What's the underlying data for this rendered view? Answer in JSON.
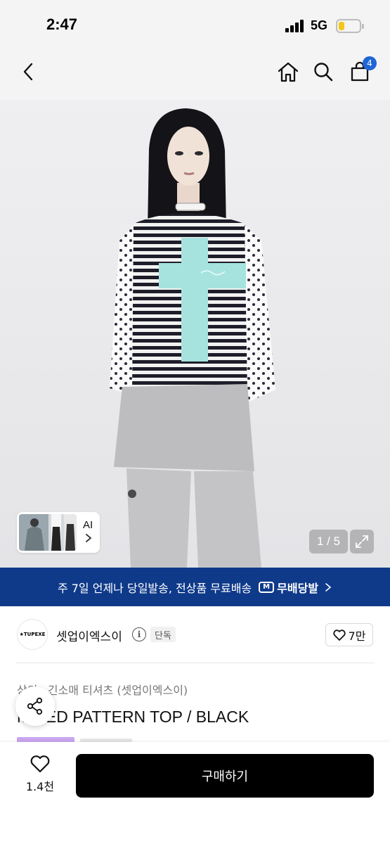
{
  "status_bar": {
    "time": "2:47",
    "network": "5G",
    "battery_level": 0.3
  },
  "nav": {
    "cart_count": "4",
    "icons": [
      "back-chevron-icon",
      "home-icon",
      "search-icon",
      "cart-icon"
    ]
  },
  "gallery": {
    "counter": "1 / 5",
    "ai_label": "AI"
  },
  "delivery_banner": {
    "text": "주 7일 언제나 당일발송, 전상품 무료배송",
    "brand": "무배당발"
  },
  "brand": {
    "logo_text": "★TUPEXE",
    "name": "셋업이엑스이",
    "badge": "단독",
    "likes": "7만"
  },
  "breadcrumb": [
    "상의",
    "긴소매 티셔츠 (셋업이엑스이)"
  ],
  "product": {
    "title": "MIXED PATTERN TOP / BLACK"
  },
  "bottom_bar": {
    "wish_count": "1.4천",
    "buy_label": "구매하기"
  },
  "colors": {
    "accent": "#1e66d6",
    "banner": "#0f3a8a",
    "buy_button": "#000000",
    "tag_purple": "#c9a6ef"
  }
}
